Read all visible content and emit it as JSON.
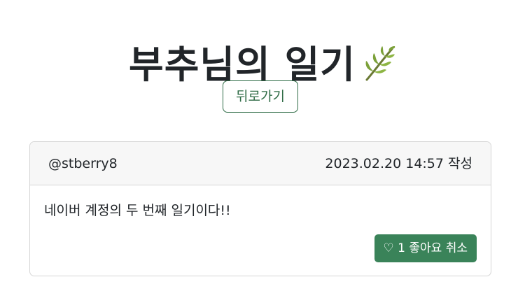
{
  "header": {
    "title": "부추님의 일기",
    "leaf_icon": "leaf-icon"
  },
  "nav": {
    "back_label": "뒤로가기"
  },
  "post": {
    "author": "@stberry8",
    "date": "2023.02.20 14:57 작성",
    "content": "네이버 계정의 두 번째 일기이다!!",
    "like": {
      "icon_glyph": "♡",
      "icon": "heart-outline-icon",
      "count": "1",
      "label": "좋아요 취소"
    }
  },
  "colors": {
    "accent_green": "#3a8359",
    "outline_green": "#2e6b45",
    "text": "#212529",
    "card_border": "#d5d5d5",
    "card_header_bg": "#f7f7f7"
  }
}
